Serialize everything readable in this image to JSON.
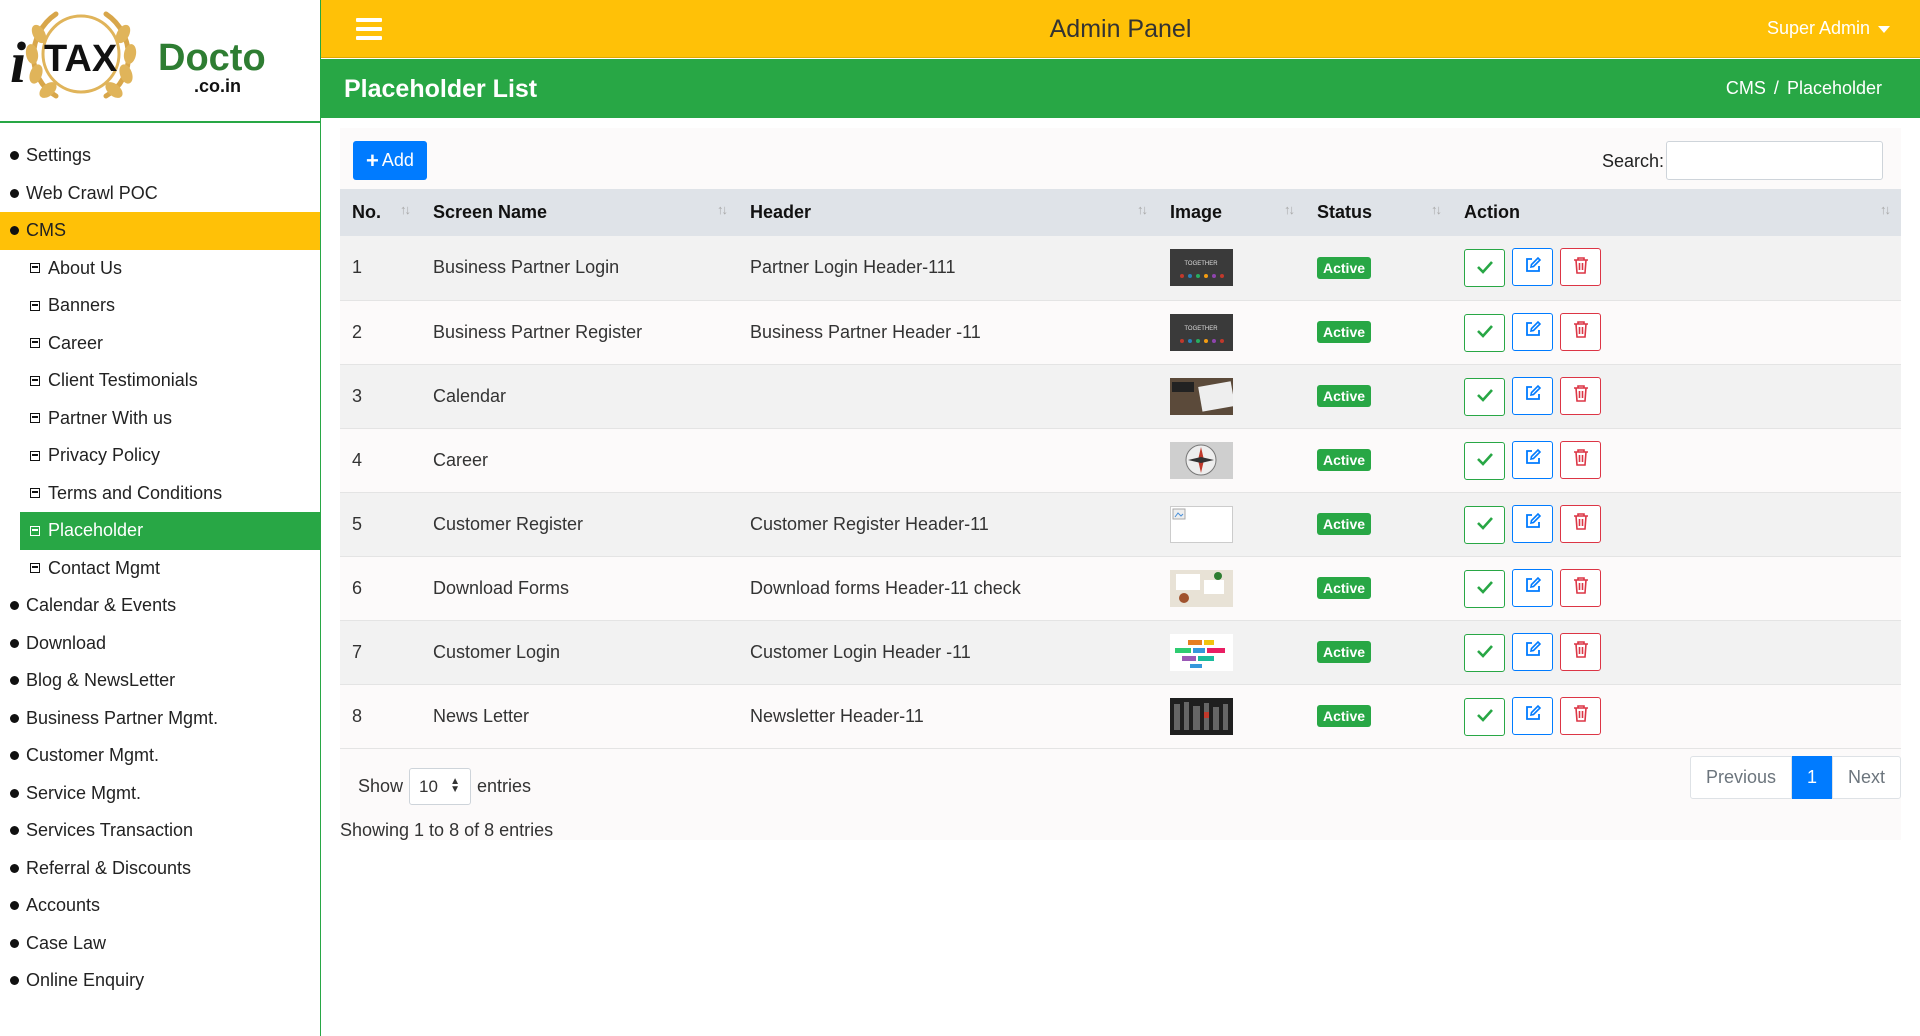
{
  "brand": {
    "logo_text": "iTAXDoctor.co.in"
  },
  "sidebar": {
    "items": [
      {
        "label": "Settings"
      },
      {
        "label": "Web Crawl POC"
      },
      {
        "label": "CMS",
        "active": true
      },
      {
        "label": "About Us",
        "sub": true
      },
      {
        "label": "Banners",
        "sub": true
      },
      {
        "label": "Career",
        "sub": true
      },
      {
        "label": "Client Testimonials",
        "sub": true
      },
      {
        "label": "Partner With us",
        "sub": true
      },
      {
        "label": "Privacy Policy",
        "sub": true
      },
      {
        "label": "Terms and Conditions",
        "sub": true
      },
      {
        "label": "Placeholder",
        "sub": true,
        "active": true
      },
      {
        "label": "Contact Mgmt",
        "sub": true
      },
      {
        "label": "Calendar & Events"
      },
      {
        "label": "Download"
      },
      {
        "label": "Blog & NewsLetter"
      },
      {
        "label": "Business Partner Mgmt."
      },
      {
        "label": "Customer Mgmt."
      },
      {
        "label": "Service Mgmt."
      },
      {
        "label": "Services Transaction"
      },
      {
        "label": "Referral & Discounts"
      },
      {
        "label": "Accounts"
      },
      {
        "label": "Case Law"
      },
      {
        "label": "Online Enquiry"
      }
    ]
  },
  "topbar": {
    "title": "Admin Panel",
    "user": "Super Admin"
  },
  "page": {
    "title": "Placeholder List",
    "breadcrumb": [
      "CMS",
      "Placeholder"
    ],
    "breadcrumb_sep": "/"
  },
  "toolbar": {
    "add_label": "Add",
    "search_label": "Search:",
    "search_value": ""
  },
  "table": {
    "columns": [
      "No.",
      "Screen Name",
      "Header",
      "Image",
      "Status",
      "Action"
    ],
    "rows": [
      {
        "no": "1",
        "screen": "Business Partner Login",
        "header": "Partner Login Header-111",
        "image": "together-chalkboard",
        "status": "Active"
      },
      {
        "no": "2",
        "screen": "Business Partner Register",
        "header": "Business Partner Header -11",
        "image": "together-chalkboard",
        "status": "Active"
      },
      {
        "no": "3",
        "screen": "Calendar",
        "header": "",
        "image": "desk-notebook",
        "status": "Active"
      },
      {
        "no": "4",
        "screen": "Career",
        "header": "",
        "image": "compass",
        "status": "Active"
      },
      {
        "no": "5",
        "screen": "Customer Register",
        "header": "Customer Register Header-11",
        "image": "broken-image",
        "status": "Active"
      },
      {
        "no": "6",
        "screen": "Download Forms",
        "header": "Download forms Header-11 check",
        "image": "paperwork",
        "status": "Active"
      },
      {
        "no": "7",
        "screen": "Customer Login",
        "header": "Customer Login Header -11",
        "image": "colored-blocks",
        "status": "Active"
      },
      {
        "no": "8",
        "screen": "News Letter",
        "header": "Newsletter Header-11",
        "image": "dark-files",
        "status": "Active"
      }
    ]
  },
  "footer": {
    "show_label": "Show",
    "page_length": "10",
    "entries_label": "entries",
    "info": "Showing 1 to 8 of 8 entries",
    "pagination": {
      "previous": "Previous",
      "current": "1",
      "next": "Next"
    }
  },
  "colors": {
    "yellow": "#ffc107",
    "green": "#28a745",
    "blue": "#007bff",
    "red": "#dc3545"
  }
}
